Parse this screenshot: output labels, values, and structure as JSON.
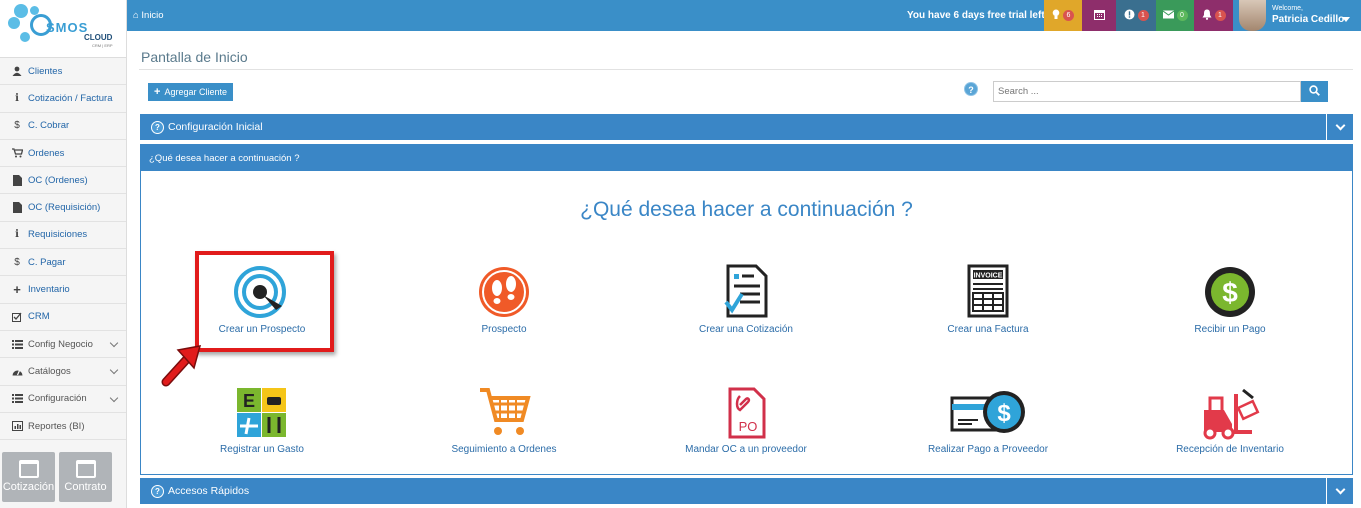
{
  "sidebar": {
    "logo": {
      "brand": "SMOS",
      "sub_brand": "CLOUD",
      "tagline": "CRM | ERP"
    },
    "items": [
      {
        "label": "Clientes",
        "icon": "user-icon"
      },
      {
        "label": "Cotización / Factura",
        "icon": "info-icon"
      },
      {
        "label": "C. Cobrar",
        "icon": "dollar-icon"
      },
      {
        "label": "Ordenes",
        "icon": "cart-icon"
      },
      {
        "label": "OC (Ordenes)",
        "icon": "file-icon"
      },
      {
        "label": "OC (Requisición)",
        "icon": "file-icon"
      },
      {
        "label": "Requisiciones",
        "icon": "info-icon"
      },
      {
        "label": "C. Pagar",
        "icon": "dollar-icon"
      },
      {
        "label": "Inventario",
        "icon": "plus-icon"
      },
      {
        "label": "CRM",
        "icon": "checkbox-icon"
      },
      {
        "label": "Config Negocio",
        "icon": "list-icon"
      },
      {
        "label": "Catálogos",
        "icon": "dashboard-icon"
      },
      {
        "label": "Configuración",
        "icon": "list-icon"
      },
      {
        "label": "Reportes (BI)",
        "icon": "bar-chart-icon"
      }
    ],
    "tiles": [
      {
        "label": "Cotización"
      },
      {
        "label": "Contrato"
      }
    ]
  },
  "topbar": {
    "breadcrumb": "Inicio",
    "trial_text": "You have 6 days free trial left",
    "buttons": [
      {
        "icon": "lightbulb-icon",
        "badge": "6",
        "color": "#e0a72a",
        "badge_color": "#d9534f"
      },
      {
        "icon": "calendar-icon",
        "badge": "",
        "color": "#8e2e6b",
        "badge_color": ""
      },
      {
        "icon": "alert-icon",
        "badge": "1",
        "color": "#3a6f8f",
        "badge_color": "#d9534f"
      },
      {
        "icon": "envelope-icon",
        "badge": "0",
        "color": "#3a9a5a",
        "badge_color": "#5cb85c"
      },
      {
        "icon": "bell-icon",
        "badge": "1",
        "color": "#8e2e6b",
        "badge_color": "#d9534f"
      }
    ],
    "user": {
      "welcome": "Welcome,",
      "name": "Patricia Cedillo"
    }
  },
  "main": {
    "page_title": "Pantalla de Inicio",
    "add_client_label": "Agregar Cliente",
    "search_placeholder": "Search ...",
    "config_panel_title": "Configuración Inicial",
    "next_panel_title": "¿Qué desea hacer a continuación ?",
    "big_question": "¿Qué desea hacer a continuación ?",
    "quick_access_title": "Accesos Rápidos",
    "actions_row1": [
      {
        "label": "Crear un Prospecto",
        "icon": "target-prospect-icon"
      },
      {
        "label": "Prospecto",
        "icon": "footprints-icon"
      },
      {
        "label": "Crear una Cotización",
        "icon": "quote-document-icon"
      },
      {
        "label": "Crear una Factura",
        "icon": "invoice-icon"
      },
      {
        "label": "Recibir un Pago",
        "icon": "dollar-coin-icon"
      }
    ],
    "actions_row2": [
      {
        "label": "Registrar un Gasto",
        "icon": "expense-categories-icon"
      },
      {
        "label": "Seguimiento a Ordenes",
        "icon": "shopping-cart-icon"
      },
      {
        "label": "Mandar OC a un proveedor",
        "icon": "po-document-icon"
      },
      {
        "label": "Realizar Pago a Proveedor",
        "icon": "card-payment-icon"
      },
      {
        "label": "Recepción de Inventario",
        "icon": "forklift-icon"
      }
    ]
  },
  "colors": {
    "accent": "#3a86c6",
    "highlight": "#e11b1b",
    "link": "#2b6ca8"
  }
}
